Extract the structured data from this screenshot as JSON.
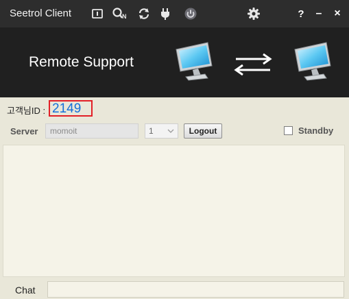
{
  "app": {
    "title": "Seetrol Client"
  },
  "toolbar": {
    "icons": [
      "info-card-icon",
      "search-key-icon",
      "refresh-icon",
      "plug-icon",
      "power-icon"
    ],
    "settings_icon": "gear-icon",
    "help_label": "?",
    "minimize_label": "–",
    "close_label": "×"
  },
  "banner": {
    "title": "Remote Support",
    "icons": [
      "monitor-icon",
      "exchange-arrows-icon",
      "monitor-icon"
    ]
  },
  "customer": {
    "id_label": "고객님ID :",
    "id_value": "2149"
  },
  "connection": {
    "server_label": "Server",
    "server_value": "momoit",
    "port_value": "1",
    "logout_label": "Logout",
    "standby_label": "Standby",
    "standby_checked": false
  },
  "chat": {
    "label": "Chat",
    "input_value": ""
  },
  "colors": {
    "titlebar": "#2d2d2d",
    "banner": "#202020",
    "body": "#e9e7d9",
    "id_value": "#1570d9",
    "highlight_border": "#e21f26"
  }
}
